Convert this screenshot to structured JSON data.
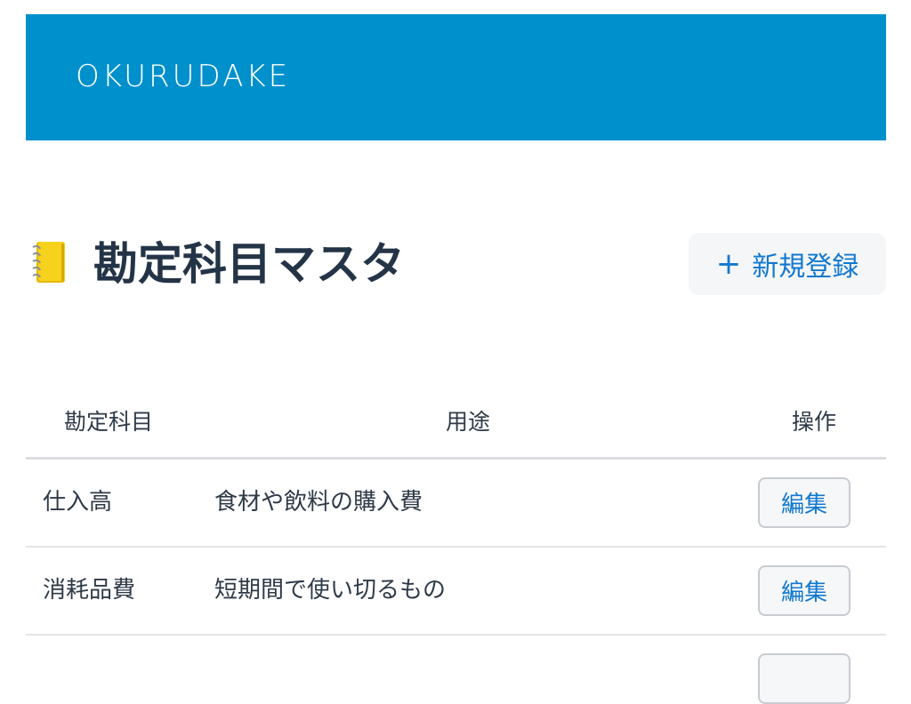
{
  "header": {
    "brand": "OKURUDAKE",
    "background_color": "#0090cc"
  },
  "page": {
    "title": "勘定科目マスタ",
    "title_icon": "notebook-icon",
    "new_button_label": "新規登録",
    "new_button_icon": "plus-icon"
  },
  "table": {
    "headers": {
      "account": "勘定科目",
      "usage": "用途",
      "action": "操作"
    },
    "rows": [
      {
        "account": "仕入高",
        "usage": "食材や飲料の購入費",
        "edit_label": "編集"
      },
      {
        "account": "消耗品費",
        "usage": "短期間で使い切るもの",
        "edit_label": "編集"
      }
    ]
  },
  "colors": {
    "accent": "#1178d0",
    "title_text": "#243447"
  }
}
